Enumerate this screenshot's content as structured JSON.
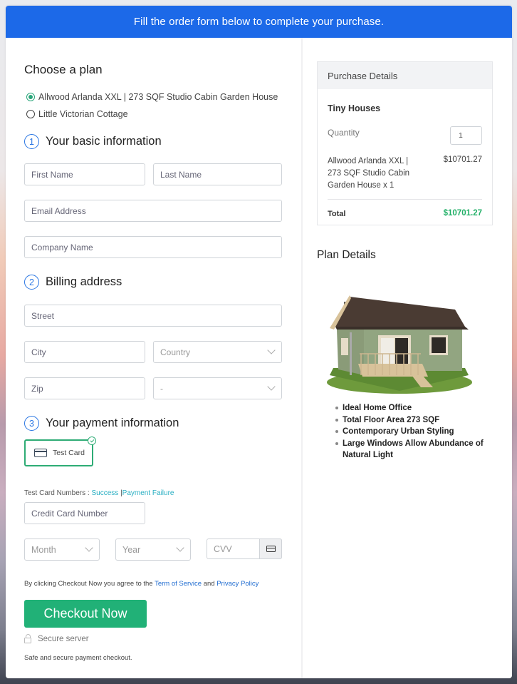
{
  "banner": {
    "text": "Fill the order form below to complete your purchase."
  },
  "plan": {
    "heading": "Choose a plan",
    "options": [
      {
        "label": "Allwood Arlanda XXL | 273 SQF Studio Cabin Garden House",
        "selected": true
      },
      {
        "label": "Little Victorian Cottage",
        "selected": false
      }
    ]
  },
  "basic": {
    "number": "1",
    "heading": "Your basic information",
    "first_name": {
      "placeholder": "First Name",
      "value": ""
    },
    "last_name": {
      "placeholder": "Last Name",
      "value": ""
    },
    "email": {
      "placeholder": "Email Address",
      "value": ""
    },
    "company": {
      "placeholder": "Company Name",
      "value": ""
    }
  },
  "billing": {
    "number": "2",
    "heading": "Billing address",
    "street": {
      "placeholder": "Street",
      "value": ""
    },
    "city": {
      "placeholder": "City",
      "value": ""
    },
    "country": {
      "selected": "Country"
    },
    "zip": {
      "placeholder": "Zip",
      "value": ""
    },
    "state": {
      "selected": "-"
    }
  },
  "payment": {
    "number": "3",
    "heading": "Your payment information",
    "method_label": "Test Card",
    "test_numbers_label": "Test Card Numbers :",
    "success_link": "Success",
    "separator": "|",
    "failure_link": "Payment Failure",
    "card_number": {
      "placeholder": "Credit Card Number",
      "value": ""
    },
    "month": {
      "selected": "Month"
    },
    "year": {
      "selected": "Year"
    },
    "cvv": {
      "placeholder": "CVV",
      "value": ""
    }
  },
  "agreement": {
    "prefix": "By clicking Checkout Now you agree to the",
    "tos_link": "Term of Service",
    "and": "and",
    "privacy_link": "Privacy Policy"
  },
  "checkout": {
    "button_label": "Checkout Now",
    "secure_label": "Secure server",
    "note": "Safe and secure payment checkout."
  },
  "purchase": {
    "heading": "Purchase Details",
    "category": "Tiny Houses",
    "quantity_label": "Quantity",
    "quantity": "1",
    "item": "Allwood Arlanda XXL | 273 SQF Studio Cabin Garden House x 1",
    "item_price": "$10701.27",
    "total_label": "Total",
    "total": "$10701.27"
  },
  "plan_details": {
    "heading": "Plan Details",
    "image_alt": "green cabin house",
    "features": [
      "Ideal Home Office",
      "Total Floor Area 273 SQF",
      "Contemporary Urban Styling",
      "Large Windows Allow Abundance of Natural Light"
    ]
  },
  "colors": {
    "brand_blue": "#1c69e8",
    "checkout_green": "#21b177",
    "total_green": "#22b068",
    "link_teal": "#27aec2",
    "link_blue": "#1e6bd0"
  }
}
